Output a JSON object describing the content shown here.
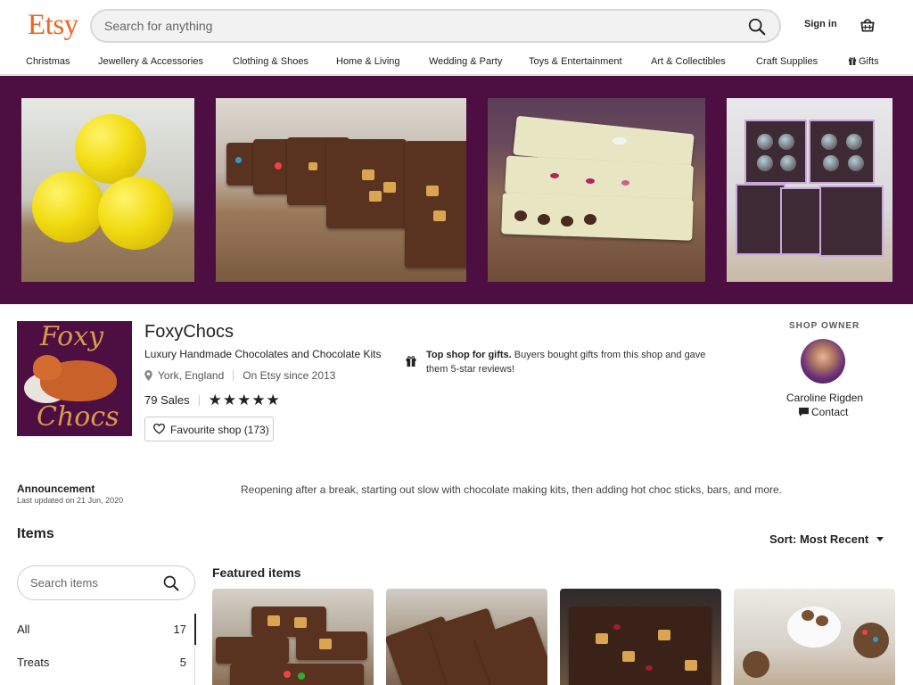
{
  "header": {
    "logo": "Etsy",
    "search_placeholder": "Search for anything",
    "signin": "Sign in"
  },
  "categories": [
    "Christmas",
    "Jewellery & Accessories",
    "Clothing & Shoes",
    "Home & Living",
    "Wedding & Party",
    "Toys & Entertainment",
    "Art & Collectibles",
    "Craft Supplies",
    "Gifts"
  ],
  "shop": {
    "logo_line1": "Foxy",
    "logo_line2": "Chocs",
    "name": "FoxyChocs",
    "tagline": "Luxury Handmade Chocolates and Chocolate Kits",
    "location": "York, England",
    "since": "On Etsy since 2013",
    "sales": "79 Sales",
    "stars": "★★★★★",
    "rating": 5,
    "favourite": "Favourite shop (173)"
  },
  "top_shop": {
    "bold": "Top shop for gifts.",
    "text": "Buyers bought gifts from this shop and gave them 5-star reviews!"
  },
  "owner": {
    "label": "SHOP OWNER",
    "name": "Caroline Rigden",
    "contact": "Contact"
  },
  "announcement": {
    "title": "Announcement",
    "date": "Last updated on 21 Jun, 2020",
    "text": "Reopening after a break, starting out slow with chocolate making kits, then adding hot choc sticks, bars, and more."
  },
  "items": {
    "title": "Items",
    "sort": "Sort: Most Recent",
    "search_placeholder": "Search items",
    "featured": "Featured items",
    "sections": [
      {
        "label": "All",
        "count": "17"
      },
      {
        "label": "Treats",
        "count": "5"
      }
    ]
  },
  "colors": {
    "brand": "#f1641e",
    "banner": "#4d0e42"
  }
}
